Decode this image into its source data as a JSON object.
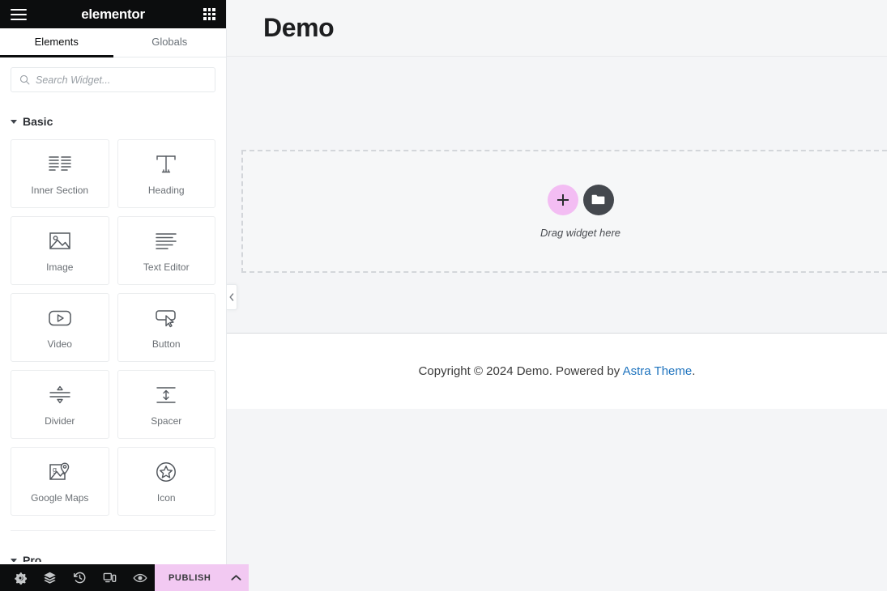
{
  "panel": {
    "brand": "elementor",
    "menu_icon": "hamburger-icon",
    "apps_icon": "grid-apps-icon",
    "tabs": [
      {
        "label": "Elements",
        "active": true
      },
      {
        "label": "Globals",
        "active": false
      }
    ],
    "search": {
      "placeholder": "Search Widget...",
      "value": "",
      "icon": "search-icon"
    },
    "sections": [
      {
        "label": "Basic",
        "expanded": true
      },
      {
        "label": "Pro",
        "expanded": true
      }
    ],
    "widgets": [
      {
        "label": "Inner Section",
        "icon": "inner-section-icon"
      },
      {
        "label": "Heading",
        "icon": "heading-icon"
      },
      {
        "label": "Image",
        "icon": "image-icon"
      },
      {
        "label": "Text Editor",
        "icon": "text-editor-icon"
      },
      {
        "label": "Video",
        "icon": "video-icon"
      },
      {
        "label": "Button",
        "icon": "button-icon"
      },
      {
        "label": "Divider",
        "icon": "divider-icon"
      },
      {
        "label": "Spacer",
        "icon": "spacer-icon"
      },
      {
        "label": "Google Maps",
        "icon": "google-maps-icon"
      },
      {
        "label": "Icon",
        "icon": "star-icon"
      }
    ],
    "footer": {
      "tools": [
        {
          "name": "settings-gear-icon",
          "title": "Settings"
        },
        {
          "name": "navigator-layers-icon",
          "title": "Navigator"
        },
        {
          "name": "history-clock-icon",
          "title": "History"
        },
        {
          "name": "responsive-devices-icon",
          "title": "Responsive Mode"
        },
        {
          "name": "preview-eye-icon",
          "title": "Preview Changes"
        }
      ],
      "publish_label": "PUBLISH",
      "publish_caret_icon": "chevron-up-icon",
      "publish_bg": "#f2c9f2"
    }
  },
  "canvas": {
    "site_title": "Demo",
    "dropzone": {
      "add_button_icon": "plus-icon",
      "folder_button_icon": "folder-icon",
      "hint": "Drag widget here",
      "add_bg": "#f3bdf3",
      "folder_bg": "#44484e"
    },
    "footer": {
      "copyright_prefix": "Copyright © 2024 Demo. Powered by ",
      "link_text": "Astra Theme",
      "suffix": ".",
      "link_color": "#1e73be"
    },
    "collapse_handle_icon": "chevron-left-icon"
  }
}
